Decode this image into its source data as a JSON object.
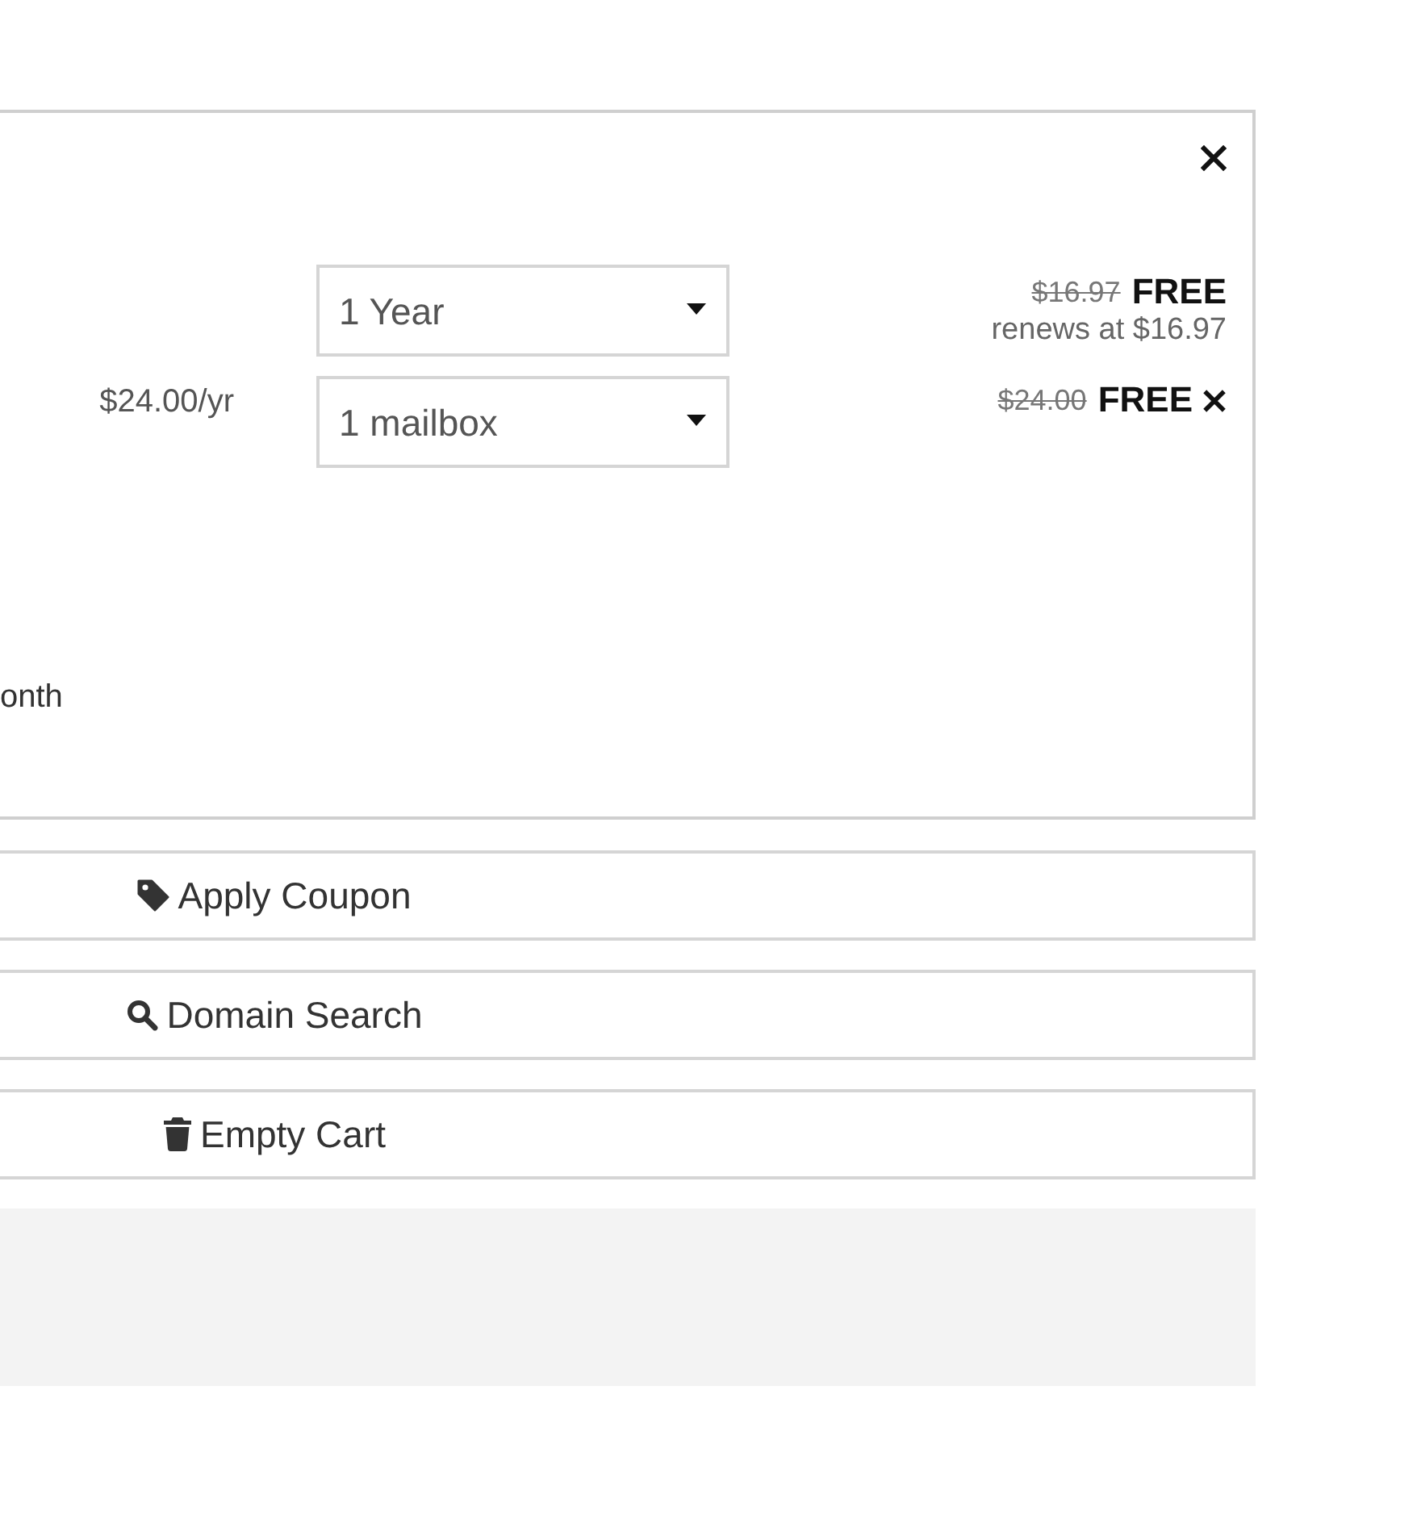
{
  "cart_item": {
    "billing_cycle": {
      "value": "1 Year"
    },
    "domain_price": {
      "original": "$16.97",
      "price": "FREE",
      "renewal": "renews at $16.97"
    },
    "addon": {
      "unit_price": "$24.00/yr",
      "value": "1 mailbox",
      "original": "$24.00",
      "price": "FREE"
    },
    "note": "onth"
  },
  "actions": [
    {
      "kind": "coupon",
      "label": "Apply Coupon"
    },
    {
      "kind": "search",
      "label": "Domain Search"
    },
    {
      "kind": "trash",
      "label": "Empty Cart"
    }
  ]
}
